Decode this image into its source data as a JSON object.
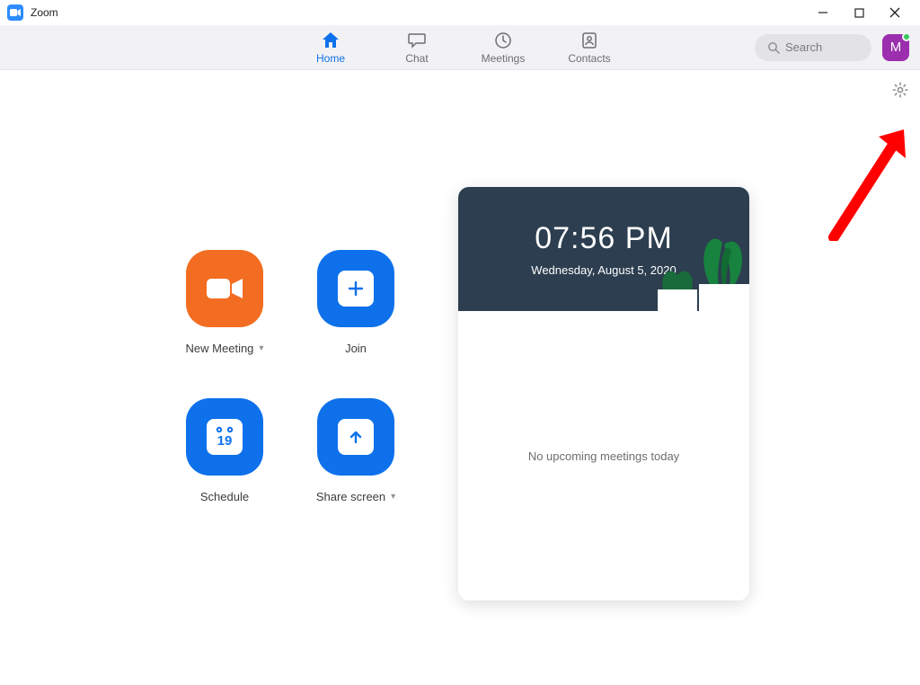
{
  "window": {
    "app_name": "Zoom"
  },
  "nav": {
    "tabs": [
      {
        "label": "Home",
        "active": true
      },
      {
        "label": "Chat",
        "active": false
      },
      {
        "label": "Meetings",
        "active": false
      },
      {
        "label": "Contacts",
        "active": false
      }
    ],
    "search_placeholder": "Search",
    "avatar_initial": "M"
  },
  "actions": {
    "new_meeting": "New Meeting",
    "join": "Join",
    "schedule": "Schedule",
    "share_screen": "Share screen",
    "calendar_day_number": "19"
  },
  "calendar": {
    "time": "07:56 PM",
    "date": "Wednesday, August 5, 2020",
    "empty_text": "No upcoming meetings today"
  }
}
